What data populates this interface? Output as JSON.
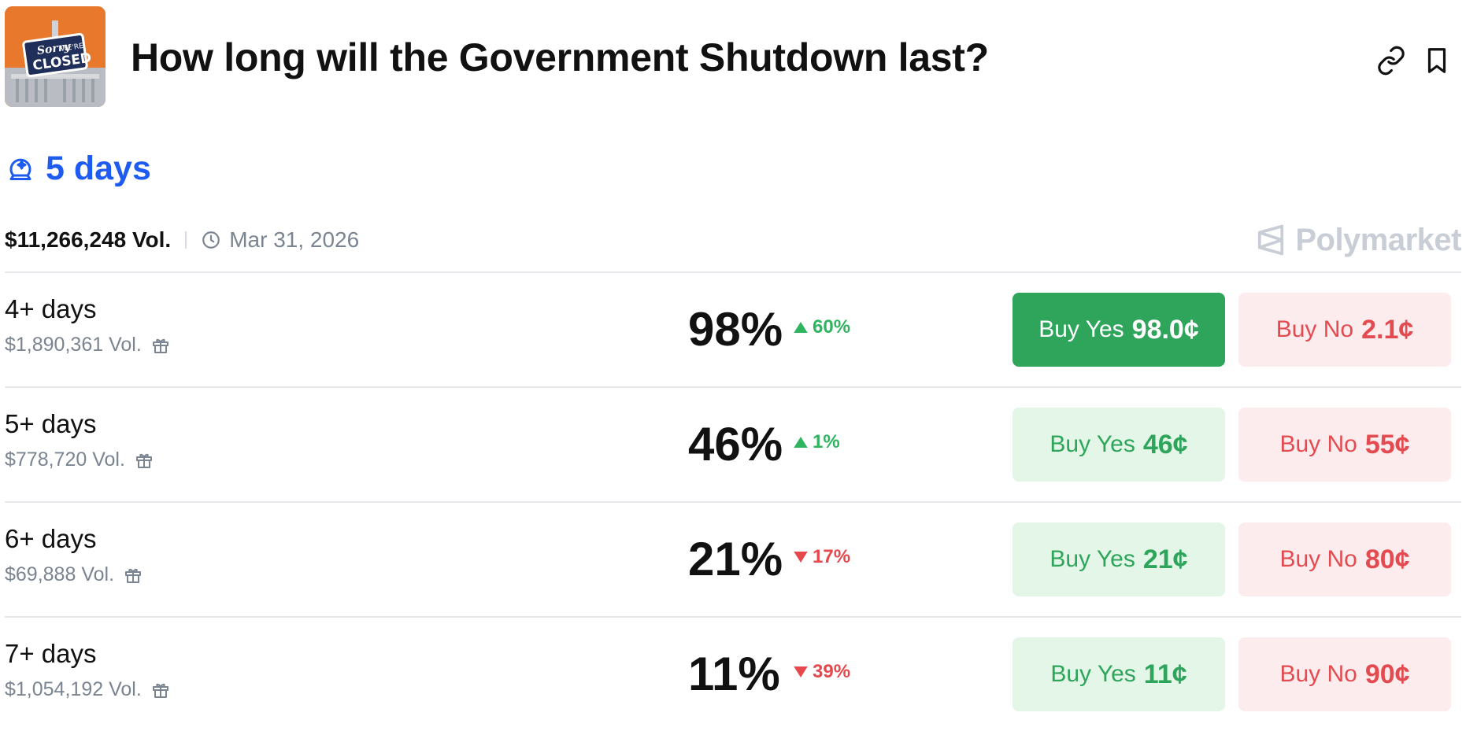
{
  "market": {
    "title": "How long will the Government Shutdown last?",
    "thumbnail_sign": {
      "line1": "Sorry",
      "line2": "WE'RE",
      "line3": "CLOSED"
    }
  },
  "header_icons": [
    "link-icon",
    "bookmark-icon"
  ],
  "leading": {
    "icon": "crystal-ball-icon",
    "text": "5 days"
  },
  "meta": {
    "volume": "$11,266,248 Vol.",
    "date": "Mar 31, 2026",
    "clock_icon": "clock-icon"
  },
  "brand": {
    "name": "Polymarket",
    "icon": "polymarket-logo-icon"
  },
  "colors": {
    "accent_blue": "#1e5bf0",
    "yes_green": "#2ea55b",
    "yes_bg": "#e3f6e7",
    "no_red": "#e34b50",
    "no_bg": "#fdeced",
    "up_green": "#2fb45f",
    "down_red": "#e5484d"
  },
  "outcomes": [
    {
      "label": "4+ days",
      "volume": "$1,890,361 Vol.",
      "percent": "98%",
      "change": "60%",
      "direction": "up",
      "yes_label": "Buy Yes",
      "yes_price": "98.0¢",
      "yes_selected": true,
      "no_label": "Buy No",
      "no_price": "2.1¢"
    },
    {
      "label": "5+ days",
      "volume": "$778,720 Vol.",
      "percent": "46%",
      "change": "1%",
      "direction": "up",
      "yes_label": "Buy Yes",
      "yes_price": "46¢",
      "yes_selected": false,
      "no_label": "Buy No",
      "no_price": "55¢"
    },
    {
      "label": "6+ days",
      "volume": "$69,888 Vol.",
      "percent": "21%",
      "change": "17%",
      "direction": "down",
      "yes_label": "Buy Yes",
      "yes_price": "21¢",
      "yes_selected": false,
      "no_label": "Buy No",
      "no_price": "80¢"
    },
    {
      "label": "7+ days",
      "volume": "$1,054,192 Vol.",
      "percent": "11%",
      "change": "39%",
      "direction": "down",
      "yes_label": "Buy Yes",
      "yes_price": "11¢",
      "yes_selected": false,
      "no_label": "Buy No",
      "no_price": "90¢"
    }
  ]
}
